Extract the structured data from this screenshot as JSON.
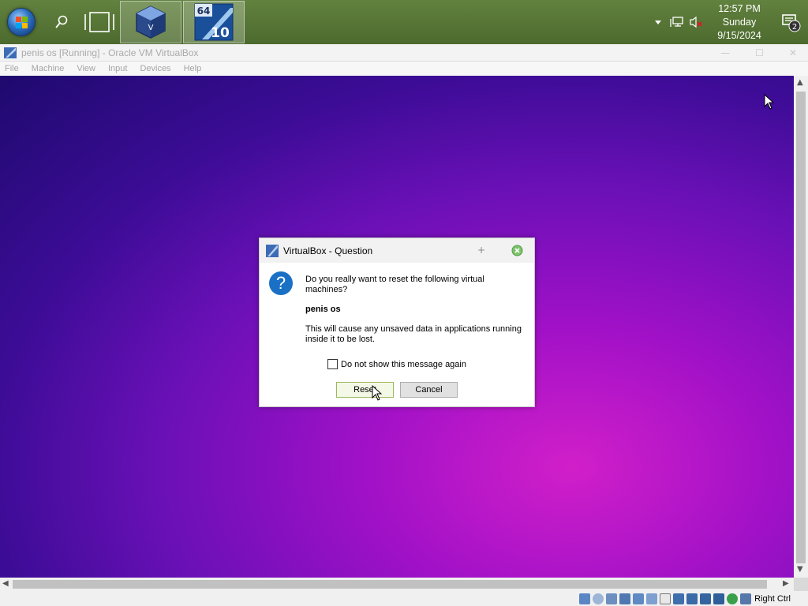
{
  "taskbar": {
    "start_icon": "windows-orb-icon",
    "search_icon": "search-icon",
    "task_view_icon": "task-view-icon",
    "apps": [
      {
        "name": "virtualbox-app-icon"
      },
      {
        "name": "windows-10-64-app-icon",
        "badge_top": "64",
        "badge_bottom": "10"
      }
    ],
    "clock": {
      "time": "12:57 PM",
      "day": "Sunday",
      "date": "9/15/2024"
    },
    "notification_count": "2",
    "colors": {
      "taskbar": "#587a38"
    }
  },
  "window": {
    "title": "penis os [Running] - Oracle VM VirtualBox",
    "menu": [
      "File",
      "Machine",
      "View",
      "Input",
      "Devices",
      "Help"
    ]
  },
  "dialog": {
    "title": "VirtualBox - Question",
    "question": "Do you really want to reset the following virtual machines?",
    "machine_name": "penis os",
    "warning": "This will cause any unsaved data in applications running inside it to be lost.",
    "checkbox_label": "Do not show this message again",
    "checkbox_checked": false,
    "buttons": {
      "reset": "Reset",
      "cancel": "Cancel"
    }
  },
  "statusbar": {
    "host_key": "Right Ctrl"
  }
}
